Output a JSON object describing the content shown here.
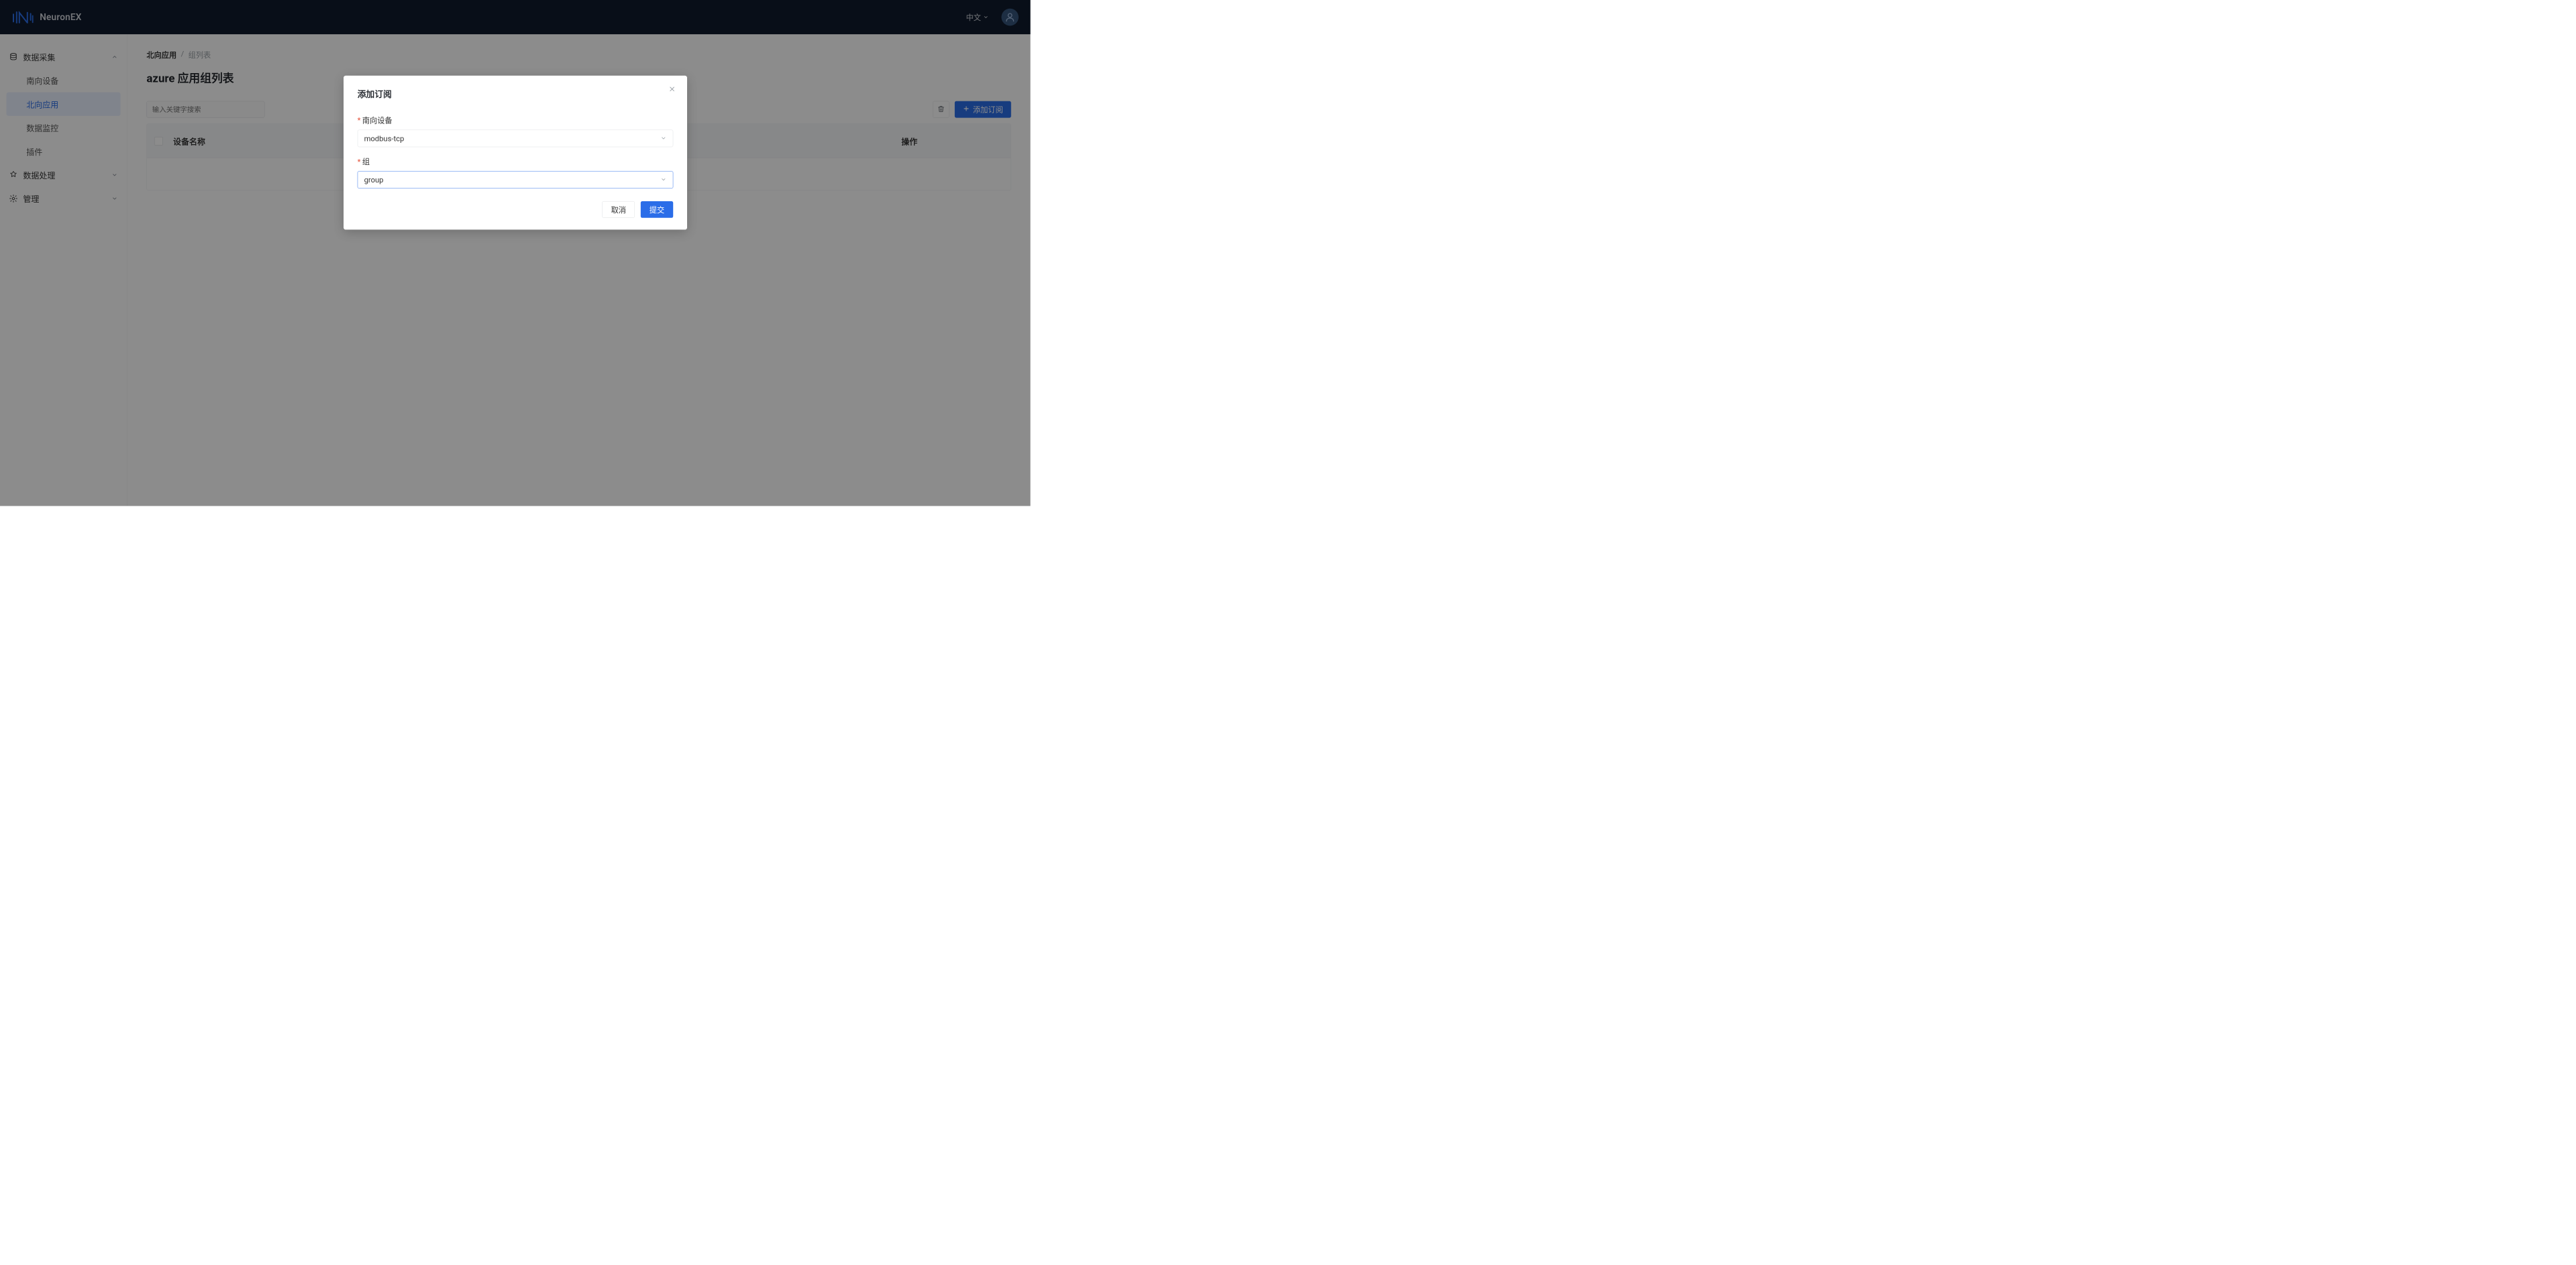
{
  "header": {
    "brand": "NeuronEX",
    "lang_label": "中文"
  },
  "sidebar": {
    "groups": [
      {
        "label": "数据采集",
        "expanded": true,
        "icon": "database"
      },
      {
        "label": "数据处理",
        "expanded": false,
        "icon": "processor"
      },
      {
        "label": "管理",
        "expanded": false,
        "icon": "gear"
      }
    ],
    "data_collection_items": [
      {
        "label": "南向设备",
        "active": false
      },
      {
        "label": "北向应用",
        "active": true
      },
      {
        "label": "数据监控",
        "active": false
      },
      {
        "label": "插件",
        "active": false
      }
    ]
  },
  "breadcrumb": {
    "root": "北向应用",
    "sep": "/",
    "current": "组列表"
  },
  "page": {
    "title": "azure 应用组列表",
    "search_placeholder": "输入关键字搜索",
    "add_subscription_label": "添加订阅"
  },
  "table": {
    "col_device_name": "设备名称",
    "col_action": "操作"
  },
  "modal": {
    "title": "添加订阅",
    "field1_label": "南向设备",
    "field1_value": "modbus-tcp",
    "field2_label": "组",
    "field2_value": "group",
    "cancel": "取消",
    "submit": "提交"
  }
}
